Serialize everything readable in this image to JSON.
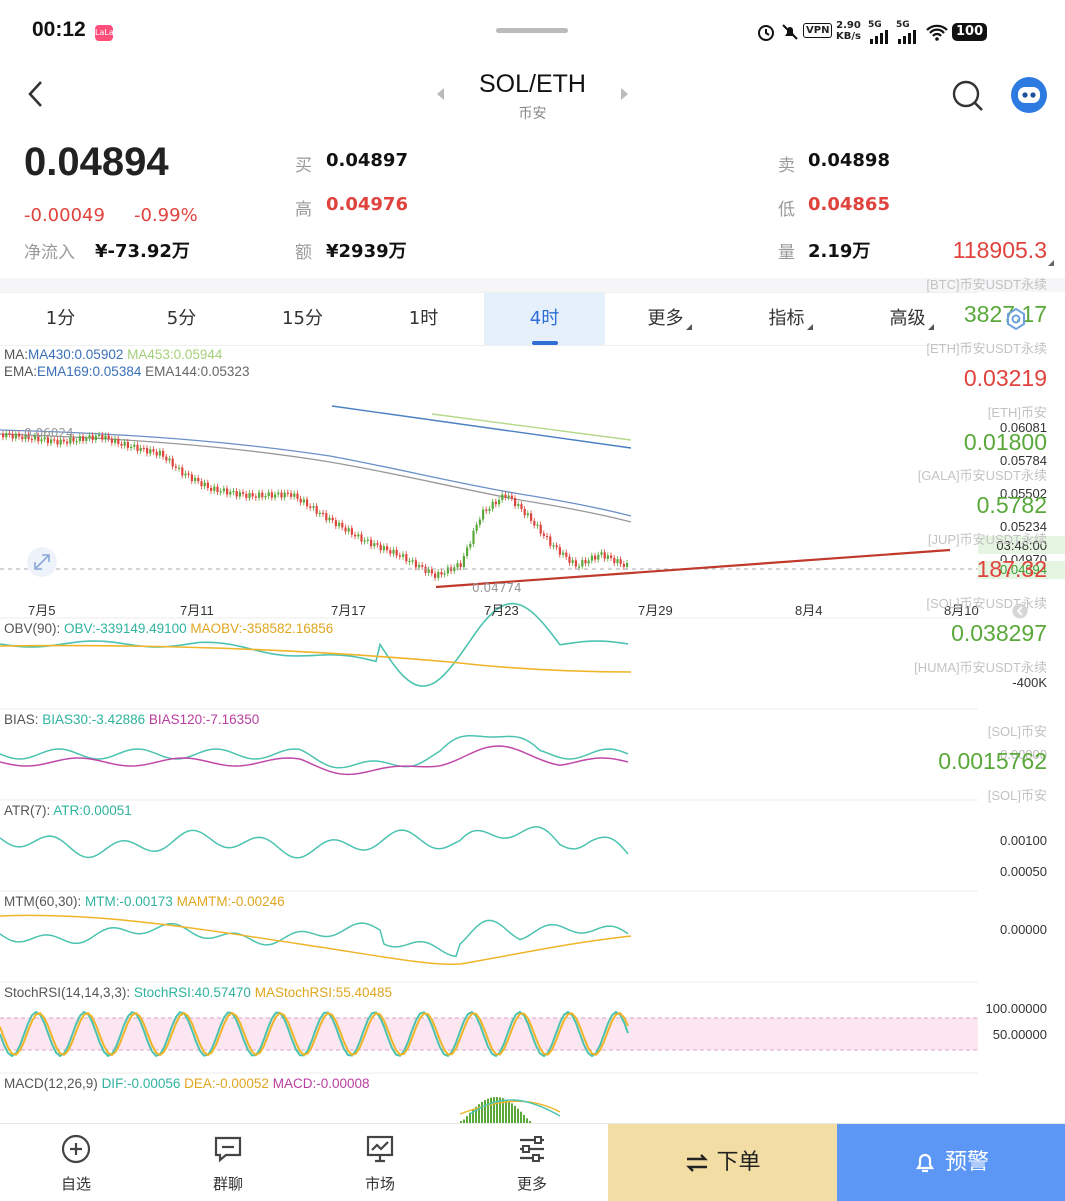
{
  "status_bar": {
    "time": "00:12",
    "app_badge": "LaLa",
    "net_speed_value": "2.90",
    "net_speed_unit": "KB/s",
    "vpn": "VPN",
    "sig1": "5G",
    "sig2": "5G",
    "battery": "100"
  },
  "header": {
    "pair": "SOL/ETH",
    "exchange": "币安"
  },
  "quote": {
    "price": "0.04894",
    "change": "-0.00049",
    "change_pct": "-0.99%",
    "netflow_label": "净流入",
    "netflow_value": "¥-73.92万",
    "bid_label": "买",
    "bid_value": "0.04897",
    "high_label": "高",
    "high_value": "0.04976",
    "amount_label": "额",
    "amount_value": "¥2939万",
    "ask_label": "卖",
    "ask_value": "0.04898",
    "low_label": "低",
    "low_value": "0.04865",
    "volume_label": "量",
    "volume_value": "2.19万"
  },
  "tabs": [
    "1分",
    "5分",
    "15分",
    "1时",
    "4时",
    "更多",
    "指标",
    "高级"
  ],
  "active_tab": "4时",
  "indicators": {
    "ma": {
      "label": "MA:",
      "ma430": "MA430:0.05902",
      "ma453": "MA453:0.05944"
    },
    "ema": {
      "label": "EMA:",
      "ema169": "EMA169:0.05384",
      "ema144": "EMA144:0.05323"
    },
    "obv": {
      "label": "OBV(90):",
      "obv": "OBV:-339149.49100",
      "maobv": "MAOBV:-358582.16856"
    },
    "bias": {
      "label": "BIAS:",
      "b30": "BIAS30:-3.42886",
      "b120": "BIAS120:-7.16350"
    },
    "atr": {
      "label": "ATR(7):",
      "atr": "ATR:0.00051"
    },
    "mtm": {
      "label": "MTM(60,30):",
      "mtm": "MTM:-0.00173",
      "mamtm": "MAMTM:-0.00246"
    },
    "stoch": {
      "label": "StochRSI(14,14,3,3):",
      "k": "StochRSI:40.57470",
      "d": "MAStochRSI:55.40485"
    },
    "macd": {
      "label": "MACD(12,26,9)",
      "dif": "DIF:-0.00056",
      "dea": "DEA:-0.00052",
      "macd": "MACD:-0.00008"
    }
  },
  "price_axis": [
    "0.06081",
    "0.05784",
    "0.05502",
    "0.05234",
    "0.04970"
  ],
  "price_high_label": "0.06024",
  "price_low_label": "0.04774",
  "countdown": "03:48:00",
  "current_price_tag": "0.04894",
  "date_axis": [
    "7月5",
    "7月11",
    "7月17",
    "7月23",
    "7月29",
    "8月4",
    "8月10"
  ],
  "sub_axes": {
    "obv": [
      "-400K"
    ],
    "bias": [
      "0.00000"
    ],
    "atr": [
      "0.00100",
      "0.00050"
    ],
    "mtm": [
      "0.00000"
    ],
    "stoch": [
      "100.00000",
      "50.00000"
    ]
  },
  "side_tickers": [
    {
      "value": "118905.3",
      "name": "[BTC]币安USDT永续",
      "color": "#e0433d"
    },
    {
      "value": "3827.17",
      "name": "[ETH]币安USDT永续",
      "color": "#5aa83a"
    },
    {
      "value": "0.03219",
      "name": "[ETH]币安",
      "color": "#e0433d"
    },
    {
      "value": "0.01800",
      "name": "[GALA]币安USDT永续",
      "color": "#5aa83a"
    },
    {
      "value": "0.5782",
      "name": "[JUP]币安USDT永续",
      "color": "#5aa83a"
    },
    {
      "value": "187.32",
      "name": "[SOL]币安USDT永续",
      "color": "#e0433d"
    },
    {
      "value": "0.038297",
      "name": "[HUMA]币安USDT永续",
      "color": "#5aa83a"
    },
    {
      "value": "0.0015762",
      "name": "[SOL]币安",
      "color": "#5aa83a"
    },
    {
      "value": "",
      "name": "[SOL]币安",
      "color": "#5aa83a"
    }
  ],
  "bottom_nav": [
    {
      "label": "自选",
      "icon": "plus-circle-icon"
    },
    {
      "label": "群聊",
      "icon": "chat-icon"
    },
    {
      "label": "市场",
      "icon": "market-chart-icon"
    },
    {
      "label": "更多",
      "icon": "more-sliders-icon"
    }
  ],
  "order_button": "下单",
  "alert_button": "预警",
  "colors": {
    "up": "#5aa83a",
    "down": "#e0433d",
    "accent": "#2f6fd6",
    "ma430": "#4a7fc4",
    "ma453": "#b5d98a",
    "trendline": "#c0392b"
  }
}
